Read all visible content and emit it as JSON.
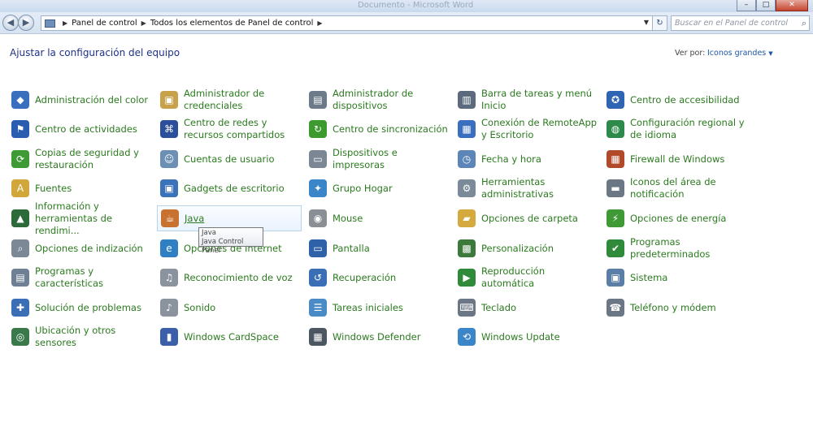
{
  "window": {
    "title": "Documento - Microsoft Word",
    "controls": {
      "minimize": "–",
      "maximize": "□",
      "close": "✕"
    }
  },
  "nav": {
    "back": "◀",
    "forward": "▶",
    "breadcrumb": [
      "Panel de control",
      "Todos los elementos de Panel de control"
    ],
    "refresh": "↻",
    "search_placeholder": "Buscar en el Panel de control"
  },
  "header": {
    "title": "Ajustar la configuración del equipo",
    "view_by_label": "Ver por:",
    "view_by_value": "Iconos grandes"
  },
  "tooltip": {
    "line1": "Java",
    "line2": "Java Control Panel"
  },
  "items": [
    {
      "label": "Administración del color",
      "icon": "color-management-icon",
      "color": "#3a6fc0",
      "glyph": "◆"
    },
    {
      "label": "Administrador de credenciales",
      "icon": "credentials-icon",
      "color": "#c8a24a",
      "glyph": "▣"
    },
    {
      "label": "Administrador de dispositivos",
      "icon": "device-manager-icon",
      "color": "#6c7a89",
      "glyph": "▤"
    },
    {
      "label": "Barra de tareas y menú Inicio",
      "icon": "taskbar-icon",
      "color": "#5b6b7d",
      "glyph": "▥"
    },
    {
      "label": "Centro de accesibilidad",
      "icon": "accessibility-icon",
      "color": "#2f64b5",
      "glyph": "✪"
    },
    {
      "label": "Centro de actividades",
      "icon": "action-center-icon",
      "color": "#2a5db0",
      "glyph": "⚑"
    },
    {
      "label": "Centro de redes y recursos compartidos",
      "icon": "network-icon",
      "color": "#2b4f9a",
      "glyph": "⌘"
    },
    {
      "label": "Centro de sincronización",
      "icon": "sync-icon",
      "color": "#3c9a2f",
      "glyph": "↻"
    },
    {
      "label": "Conexión de RemoteApp y Escritorio",
      "icon": "remoteapp-icon",
      "color": "#3a6fc0",
      "glyph": "▦"
    },
    {
      "label": "Configuración regional y de idioma",
      "icon": "region-icon",
      "color": "#2e8a4a",
      "glyph": "◍"
    },
    {
      "label": "Copias de seguridad y restauración",
      "icon": "backup-icon",
      "color": "#3f9a36",
      "glyph": "⟳"
    },
    {
      "label": "Cuentas de usuario",
      "icon": "user-accounts-icon",
      "color": "#6b8fb5",
      "glyph": "☺"
    },
    {
      "label": "Dispositivos e impresoras",
      "icon": "printer-icon",
      "color": "#7b8794",
      "glyph": "▭"
    },
    {
      "label": "Fecha y hora",
      "icon": "clock-icon",
      "color": "#5c86b8",
      "glyph": "◷"
    },
    {
      "label": "Firewall de Windows",
      "icon": "firewall-icon",
      "color": "#b04a2a",
      "glyph": "▦"
    },
    {
      "label": "Fuentes",
      "icon": "fonts-icon",
      "color": "#d1a63a",
      "glyph": "A"
    },
    {
      "label": "Gadgets de escritorio",
      "icon": "gadgets-icon",
      "color": "#3b72b9",
      "glyph": "▣"
    },
    {
      "label": "Grupo Hogar",
      "icon": "homegroup-icon",
      "color": "#3a86c9",
      "glyph": "✦"
    },
    {
      "label": "Herramientas administrativas",
      "icon": "admin-tools-icon",
      "color": "#7a8a99",
      "glyph": "⚙"
    },
    {
      "label": "Iconos del área de notificación",
      "icon": "notification-area-icon",
      "color": "#6b7785",
      "glyph": "▬"
    },
    {
      "label": "Información y herramientas de rendimi...",
      "icon": "performance-icon",
      "color": "#2d6a3a",
      "glyph": "▲"
    },
    {
      "label": "Java",
      "icon": "java-icon",
      "color": "#c9712f",
      "glyph": "☕"
    },
    {
      "label": "Mouse",
      "icon": "mouse-icon",
      "color": "#8a8f96",
      "glyph": "◉"
    },
    {
      "label": "Opciones de carpeta",
      "icon": "folder-options-icon",
      "color": "#d4a93e",
      "glyph": "▰"
    },
    {
      "label": "Opciones de energía",
      "icon": "power-options-icon",
      "color": "#3f9a36",
      "glyph": "⚡"
    },
    {
      "label": "Opciones de indización",
      "icon": "indexing-icon",
      "color": "#7c8896",
      "glyph": "⌕"
    },
    {
      "label": "Opciones de Internet",
      "icon": "internet-options-icon",
      "color": "#2f7fc4",
      "glyph": "e"
    },
    {
      "label": "Pantalla",
      "icon": "display-icon",
      "color": "#2d62a8",
      "glyph": "▭"
    },
    {
      "label": "Personalización",
      "icon": "personalization-icon",
      "color": "#3b7a3a",
      "glyph": "▩"
    },
    {
      "label": "Programas predeterminados",
      "icon": "default-programs-icon",
      "color": "#2f8a3a",
      "glyph": "✔"
    },
    {
      "label": "Programas y características",
      "icon": "programs-icon",
      "color": "#6f8094",
      "glyph": "▤"
    },
    {
      "label": "Reconocimiento de voz",
      "icon": "microphone-icon",
      "color": "#8b949e",
      "glyph": "♫"
    },
    {
      "label": "Recuperación",
      "icon": "recovery-icon",
      "color": "#3b6fb5",
      "glyph": "↺"
    },
    {
      "label": "Reproducción automática",
      "icon": "autoplay-icon",
      "color": "#2f8a3a",
      "glyph": "▶"
    },
    {
      "label": "Sistema",
      "icon": "system-icon",
      "color": "#5b7ea6",
      "glyph": "▣"
    },
    {
      "label": "Solución de problemas",
      "icon": "troubleshooting-icon",
      "color": "#3b6fb5",
      "glyph": "✚"
    },
    {
      "label": "Sonido",
      "icon": "sound-icon",
      "color": "#8b949e",
      "glyph": "♪"
    },
    {
      "label": "Tareas iniciales",
      "icon": "getting-started-icon",
      "color": "#4a8bc7",
      "glyph": "☰"
    },
    {
      "label": "Teclado",
      "icon": "keyboard-icon",
      "color": "#6b7785",
      "glyph": "⌨"
    },
    {
      "label": "Teléfono y módem",
      "icon": "phone-modem-icon",
      "color": "#6b7785",
      "glyph": "☎"
    },
    {
      "label": "Ubicación y otros sensores",
      "icon": "location-sensors-icon",
      "color": "#3a7a4a",
      "glyph": "◎"
    },
    {
      "label": "Windows CardSpace",
      "icon": "cardspace-icon",
      "color": "#3b5fa8",
      "glyph": "▮"
    },
    {
      "label": "Windows Defender",
      "icon": "defender-icon",
      "color": "#4c5662",
      "glyph": "▦"
    },
    {
      "label": "Windows Update",
      "icon": "windows-update-icon",
      "color": "#3a86c9",
      "glyph": "⟲"
    }
  ]
}
